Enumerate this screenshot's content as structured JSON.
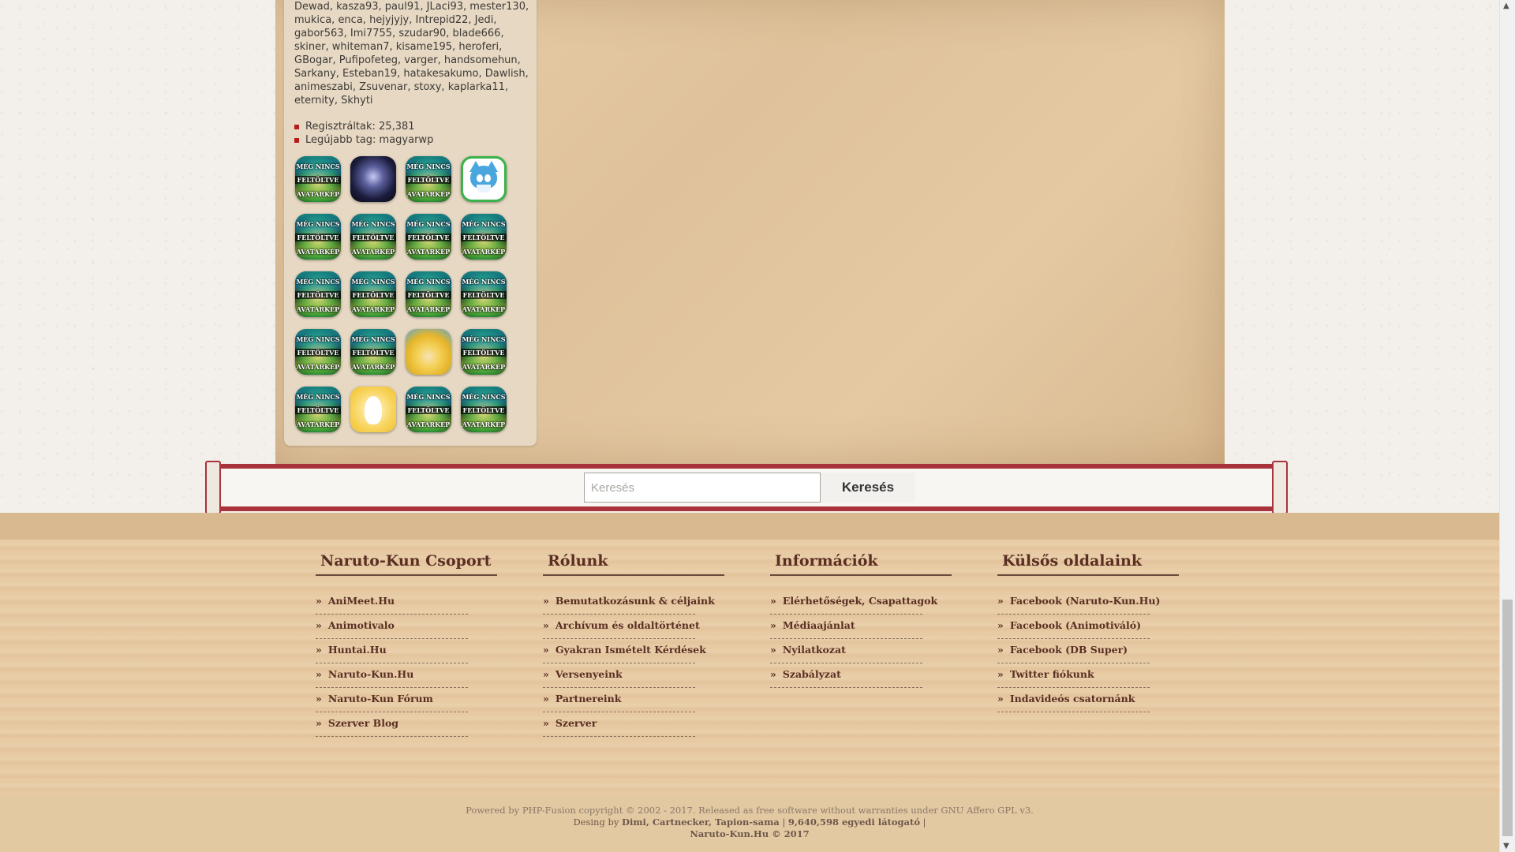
{
  "online_users": [
    "Dewad",
    "kasza93",
    "paul91",
    "JLaci93",
    "mester130",
    "mukica",
    "enca",
    "hejyjyjy",
    "Intrepid22",
    "Jedi",
    "gabor563",
    "Imi7755",
    "szudar90",
    "blade666",
    "skiner",
    "whiteman7",
    "kisame195",
    "heroferi",
    "GBogar",
    "Pufipofeteg",
    "varger",
    "handsomehun",
    "Sarkany",
    "Esteban19",
    "hatakesakumo",
    "Dawlish",
    "animeszabi",
    "Zsuvenar",
    "stoxy",
    "kaplarka11",
    "eternity",
    "Skhyti"
  ],
  "stats": {
    "registered": "Regisztráltak: 25,381",
    "newest": "Legújabb tag: magyarwp"
  },
  "avatar_default_text": [
    "MÉG NINCS",
    "FELTÖLTVE",
    "AVATARKÉP"
  ],
  "avatars": [
    "default",
    "dark-figure",
    "default",
    "blue-cat",
    "default",
    "default",
    "default",
    "default",
    "default",
    "default",
    "default",
    "default",
    "default",
    "default",
    "blond-hero",
    "default",
    "default",
    "white-fox",
    "default",
    "default"
  ],
  "search": {
    "placeholder": "Keresés",
    "button": "Keresés"
  },
  "footer": {
    "columns": [
      {
        "title": "Naruto-Kun Csoport",
        "links": [
          "AniMeet.Hu",
          "Animotivalo",
          "Huntai.Hu",
          "Naruto-Kun.Hu",
          "Naruto-Kun Fórum",
          "Szerver Blog"
        ]
      },
      {
        "title": "Rólunk",
        "links": [
          "Bemutatkozásunk & céljaink",
          "Archívum és oldaltörténet",
          "Gyakran Ismételt Kérdések",
          "Versenyeink",
          "Partnereink",
          "Szerver"
        ]
      },
      {
        "title": "Információk",
        "links": [
          "Elérhetőségek, Csapattagok",
          "Médiaajánlat",
          "Nyilatkozat",
          "Szabályzat"
        ]
      },
      {
        "title": "Külsős oldalaink",
        "links": [
          "Facebook (Naruto-Kun.Hu)",
          "Facebook (Animotiváló)",
          "Facebook (DB Super)",
          "Twitter fiókunk",
          "Indavideós csatornánk"
        ]
      }
    ],
    "credits": {
      "line1": "Powered by PHP-Fusion copyright © 2002 - 2017. Released as free software without warranties under GNU Affero GPL v3.",
      "line2_prefix": "Desing by ",
      "line2_names": "Dimi, Cartnecker, Tapion-sama",
      "line2_sep": " | ",
      "line2_count": "9,640,598 egyedi látogató",
      "line2_suffix": " |",
      "line3": "Naruto-Kun.Hu © 2017"
    }
  },
  "colors": {
    "accent_red": "#a8333a",
    "footer_text": "#5a2e23",
    "paper": "#dfc29b"
  },
  "icons": {
    "scroll_up": "arrow-up-icon",
    "scroll_down": "arrow-down-icon"
  }
}
